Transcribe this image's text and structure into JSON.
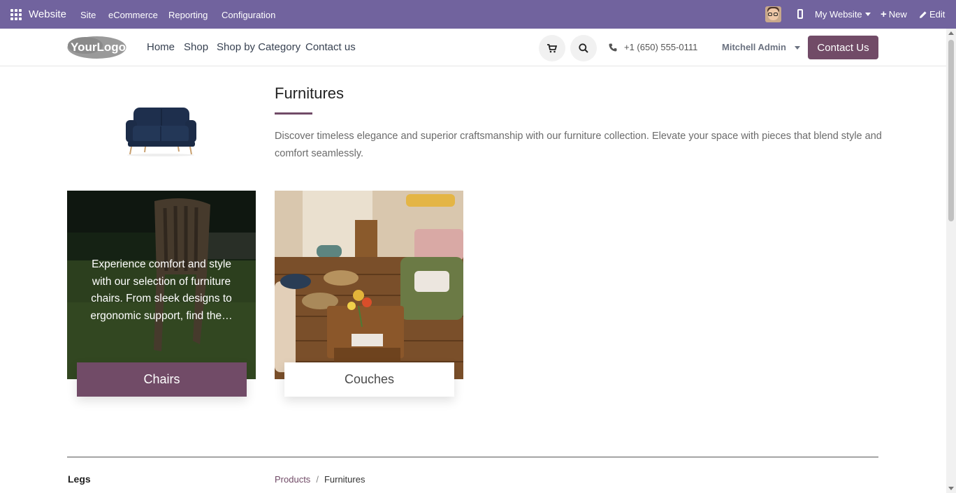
{
  "admin_bar": {
    "brand": "Website",
    "menu": [
      "Site",
      "eCommerce",
      "Reporting",
      "Configuration"
    ],
    "website_selector": "My Website",
    "new_label": "New",
    "edit_label": "Edit",
    "bg_color": "#71639e"
  },
  "header": {
    "logo_text": "YourLogo",
    "nav": [
      "Home",
      "Shop",
      "Shop by Category",
      "Contact us"
    ],
    "phone": "+1 (650) 555-0111",
    "user": "Mitchell Admin",
    "contact_button": "Contact Us",
    "accent_color": "#714b67"
  },
  "category": {
    "title": "Furnitures",
    "description": "Discover timeless elegance and superior craftsmanship with our furniture collection. Elevate your space with pieces that blend style and comfort seamlessly."
  },
  "cards": [
    {
      "label": "Chairs",
      "overlay_text": "Experience comfort and style with our selection of furniture chairs. From sleek designs to ergonomic support, find the…"
    },
    {
      "label": "Couches",
      "overlay_text": ""
    }
  ],
  "footer_strip": {
    "sidebar_heading": "Legs",
    "breadcrumb": [
      "Products",
      "Furnitures"
    ],
    "breadcrumb_sep": "/"
  }
}
